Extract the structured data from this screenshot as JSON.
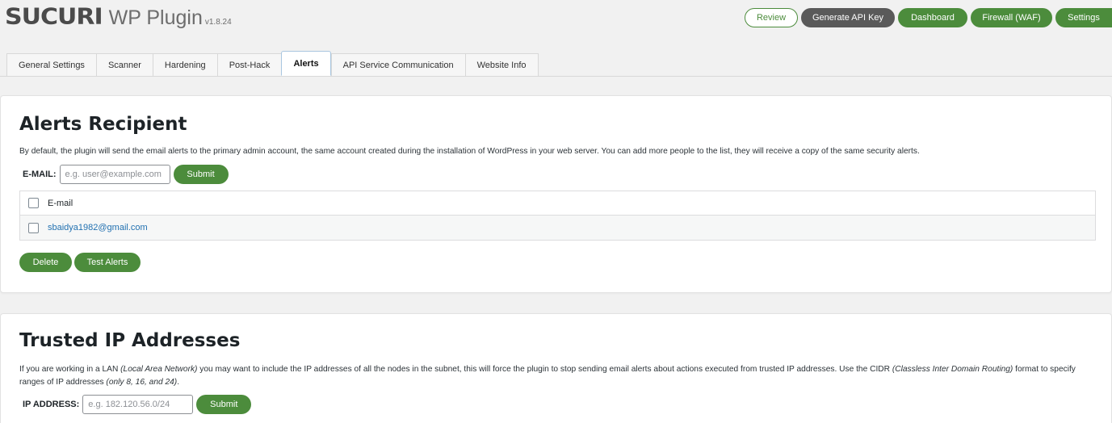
{
  "header": {
    "logo_mark": "SUCURI",
    "app_name": "WP Plugin",
    "version": "v1.8.24",
    "buttons": {
      "review": "Review",
      "generate_api_key": "Generate API Key",
      "dashboard": "Dashboard",
      "firewall": "Firewall (WAF)",
      "settings": "Settings"
    }
  },
  "tabs": [
    {
      "label": "General Settings"
    },
    {
      "label": "Scanner"
    },
    {
      "label": "Hardening"
    },
    {
      "label": "Post-Hack"
    },
    {
      "label": "Alerts",
      "active": true
    },
    {
      "label": "API Service Communication"
    },
    {
      "label": "Website Info"
    }
  ],
  "alerts_recipient": {
    "title": "Alerts Recipient",
    "description": "By default, the plugin will send the email alerts to the primary admin account, the same account created during the installation of WordPress in your web server. You can add more people to the list, they will receive a copy of the same security alerts.",
    "email_label": "E-MAIL:",
    "email_placeholder": "e.g. user@example.com",
    "submit_label": "Submit",
    "table_header": "E-mail",
    "rows": [
      {
        "email": "sbaidya1982@gmail.com"
      }
    ],
    "delete_label": "Delete",
    "test_alerts_label": "Test Alerts"
  },
  "trusted_ips": {
    "title": "Trusted IP Addresses",
    "desc_part1": "If you are working in a LAN ",
    "desc_em1": "(Local Area Network)",
    "desc_part2": " you may want to include the IP addresses of all the nodes in the subnet, this will force the plugin to stop sending email alerts about actions executed from trusted IP addresses. Use the CIDR ",
    "desc_em2": "(Classless Inter Domain Routing)",
    "desc_part3": " format to specify ranges of IP addresses ",
    "desc_em3": "(only 8, 16, and 24)",
    "desc_part4": ".",
    "ip_label": "IP ADDRESS:",
    "ip_placeholder": "e.g. 182.120.56.0/24",
    "submit_label": "Submit"
  },
  "colors": {
    "brand_green": "#4c8c3c",
    "dark_button": "#5a5a5a",
    "link_blue": "#2271b1"
  }
}
